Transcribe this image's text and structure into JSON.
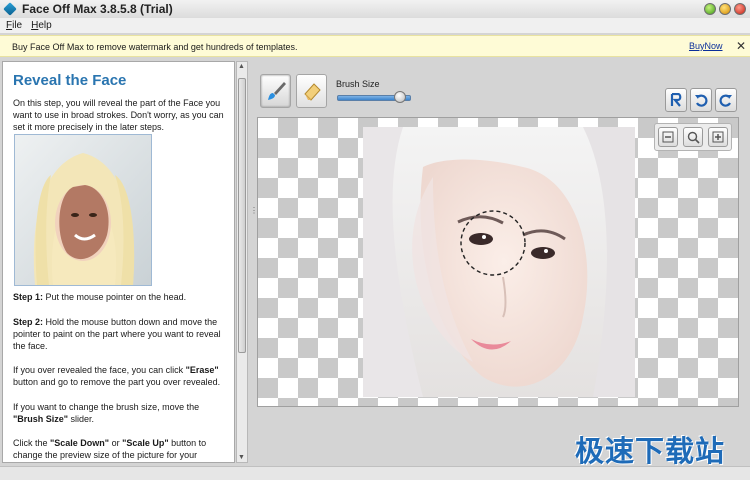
{
  "window": {
    "title": "Face Off Max  3.8.5.8  (Trial)"
  },
  "menu": {
    "items": [
      {
        "key": "F",
        "rest": "ile"
      },
      {
        "key": "H",
        "rest": "elp"
      }
    ]
  },
  "banner": {
    "text": "Buy Face Off Max to remove watermark and get hundreds of templates.",
    "link": "BuyNow",
    "close": "✕"
  },
  "panel": {
    "title": "Reveal the Face",
    "intro": "On this step, you will reveal the part of the Face you want to use in broad strokes. Don't worry, as you can set it more precisely in the later steps.",
    "step1_label": "Step 1:",
    "step1_text": " Put the mouse pointer on the head.",
    "step2_label": "Step 2:",
    "step2_text": " Hold the mouse button down and move the pointer to paint on the part where you want to reveal the face.",
    "tip1_pre": "If you over revealed the face, you can click ",
    "tip1_bold": "\"Erase\"",
    "tip1_post": " button and go to remove the part you over revealed.",
    "tip2_pre": "If you want to change the brush size, move the ",
    "tip2_bold": "\"Brush Size\"",
    "tip2_post": " slider.",
    "tip3_pre": "Click the ",
    "tip3_bold1": "\"Scale Down\"",
    "tip3_mid": " or ",
    "tip3_bold2": "\"Scale Up\"",
    "tip3_post": " button to change the preview size of the picture for your"
  },
  "toolbar": {
    "brush_size_label": "Brush Size",
    "brush_size_fraction": 0.85,
    "tools": [
      "paint-brush-icon",
      "eraser-icon"
    ],
    "actions": [
      "reset-icon",
      "undo-icon",
      "redo-icon"
    ]
  },
  "zoom": {
    "controls": [
      "zoom-out-icon",
      "zoom-fit-icon",
      "zoom-in-icon"
    ]
  },
  "watermark": {
    "text": "极速下载站"
  },
  "colors": {
    "accent_title": "#2a75b0",
    "banner_bg": "#fefbd6",
    "link": "#0a2f9a"
  }
}
